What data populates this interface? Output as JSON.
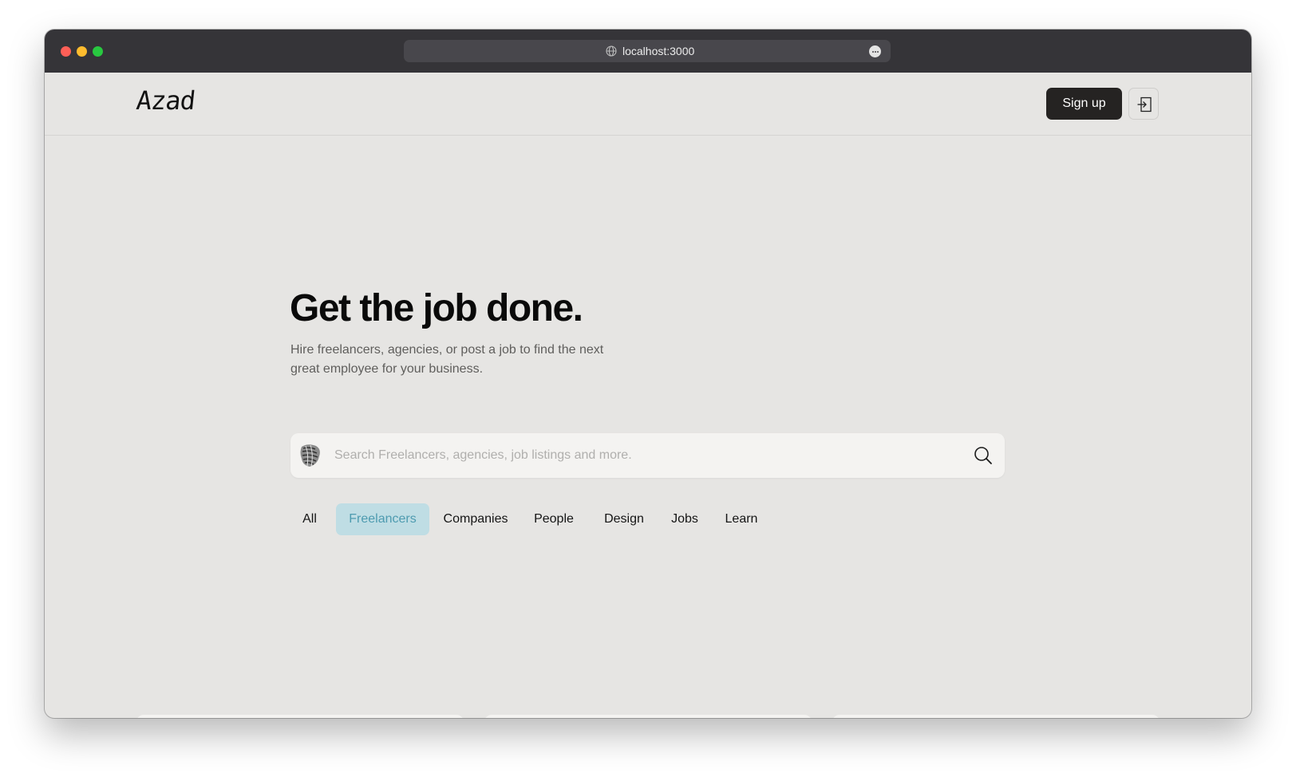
{
  "browser": {
    "url": "localhost:3000",
    "window_controls": [
      "close",
      "minimize",
      "maximize"
    ],
    "url_icon": "globe-icon",
    "more_icon": "ellipsis-icon"
  },
  "header": {
    "logo": "Azad",
    "signup_label": "Sign up",
    "login_icon": "sign-in-icon"
  },
  "hero": {
    "title": "Get the job done.",
    "subtitle": "Hire freelancers, agencies, or post a job to find the next great employee for your business."
  },
  "search": {
    "placeholder": "Search Freelancers, agencies, job listings and more.",
    "value": "",
    "logo_icon": "abstract-shell-logo",
    "button_icon": "search-icon"
  },
  "tabs": [
    {
      "label": "All",
      "active": false
    },
    {
      "label": "Freelancers",
      "active": true
    },
    {
      "label": "Companies",
      "active": false
    },
    {
      "label": "People",
      "active": false
    },
    {
      "label": "Design",
      "active": false
    },
    {
      "label": "Jobs",
      "active": false
    },
    {
      "label": "Learn",
      "active": false
    }
  ],
  "cards": [
    {
      "avatar": "red-panda-photo"
    },
    {
      "avatar": "grey-pattern-avatar"
    },
    {
      "avatar": "blue-texture-avatar"
    }
  ],
  "colors": {
    "page_background": "#e6e5e3",
    "primary_button": "#252322",
    "active_tab_bg": "#bfdde4",
    "active_tab_text": "#4e9bb0",
    "titlebar": "#353438"
  }
}
